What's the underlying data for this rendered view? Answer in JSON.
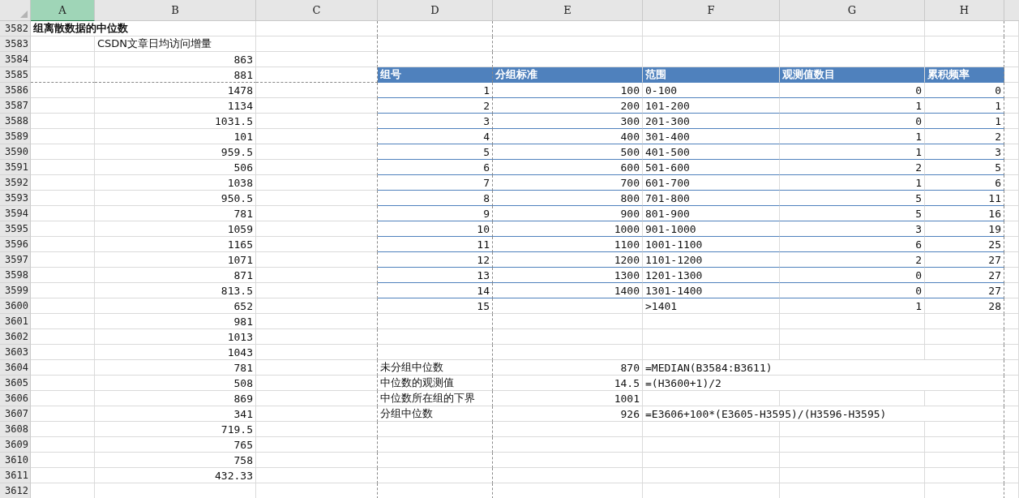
{
  "column_headers": [
    {
      "label": "A",
      "selected": true
    },
    {
      "label": "B",
      "selected": false
    },
    {
      "label": "C",
      "selected": false
    },
    {
      "label": "D",
      "selected": false
    },
    {
      "label": "E",
      "selected": false
    },
    {
      "label": "F",
      "selected": false
    },
    {
      "label": "G",
      "selected": false
    },
    {
      "label": "H",
      "selected": false
    }
  ],
  "row_numbers": [
    "3582",
    "3583",
    "3584",
    "3585",
    "3586",
    "3587",
    "3588",
    "3589",
    "3590",
    "3591",
    "3592",
    "3593",
    "3594",
    "3595",
    "3596",
    "3597",
    "3598",
    "3599",
    "3600",
    "3601",
    "3602",
    "3603",
    "3604",
    "3605",
    "3606",
    "3607",
    "3608",
    "3609",
    "3610",
    "3611",
    "3612"
  ],
  "sheet_title": "组离散数据的中位数",
  "series_header": "CSDN文章日均访问增量",
  "series_values": [
    "863",
    "881",
    "1478",
    "1134",
    "1031.5",
    "101",
    "959.5",
    "506",
    "1038",
    "950.5",
    "781",
    "1059",
    "1165",
    "1071",
    "871",
    "813.5",
    "652",
    "981",
    "1013",
    "1043",
    "781",
    "508",
    "869",
    "341",
    "719.5",
    "765",
    "758",
    "432.33"
  ],
  "group_table": {
    "columns": [
      "组号",
      "分组标准",
      "范围",
      "观测值数目",
      "累积频率"
    ],
    "rows": [
      [
        "1",
        "100",
        "0-100",
        "0",
        "0"
      ],
      [
        "2",
        "200",
        "101-200",
        "1",
        "1"
      ],
      [
        "3",
        "300",
        "201-300",
        "0",
        "1"
      ],
      [
        "4",
        "400",
        "301-400",
        "1",
        "2"
      ],
      [
        "5",
        "500",
        "401-500",
        "1",
        "3"
      ],
      [
        "6",
        "600",
        "501-600",
        "2",
        "5"
      ],
      [
        "7",
        "700",
        "601-700",
        "1",
        "6"
      ],
      [
        "8",
        "800",
        "701-800",
        "5",
        "11"
      ],
      [
        "9",
        "900",
        "801-900",
        "5",
        "16"
      ],
      [
        "10",
        "1000",
        "901-1000",
        "3",
        "19"
      ],
      [
        "11",
        "1100",
        "1001-1100",
        "6",
        "25"
      ],
      [
        "12",
        "1200",
        "1101-1200",
        "2",
        "27"
      ],
      [
        "13",
        "1300",
        "1201-1300",
        "0",
        "27"
      ],
      [
        "14",
        "1400",
        "1301-1400",
        "0",
        "27"
      ],
      [
        "15",
        null,
        ">1401",
        "1",
        "28"
      ]
    ]
  },
  "median_summary": [
    {
      "label": "未分组中位数",
      "value": "870",
      "formula": "=MEDIAN(B3584:B3611)"
    },
    {
      "label": "中位数的观测值",
      "value": "14.5",
      "formula": "=(H3600+1)/2"
    },
    {
      "label": "中位数所在组的下界",
      "value": "1001"
    },
    {
      "label": "分组中位数",
      "value": "926",
      "formula": "=E3606+100*(E3605-H3595)/(H3596-H3595)"
    }
  ]
}
